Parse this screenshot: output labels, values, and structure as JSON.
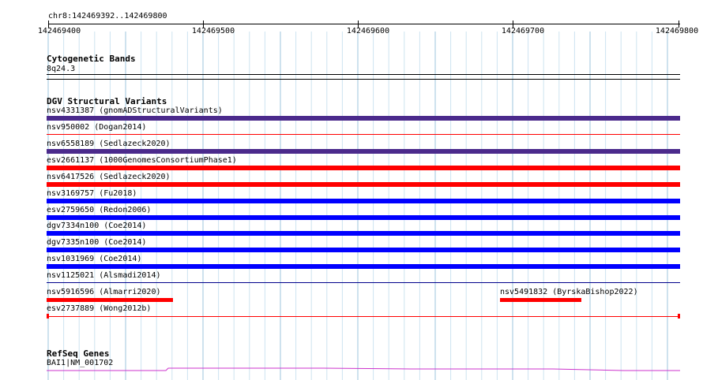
{
  "ruler": {
    "location": "chr8:142469392..142469800",
    "ticks": [
      "142469400",
      "142469500",
      "142469600",
      "142469700",
      "142469800"
    ]
  },
  "tracks": {
    "cytoband": {
      "title": "Cytogenetic Bands",
      "band": "8q24.3"
    },
    "dgv": {
      "title": "DGV Structural Variants",
      "features": [
        {
          "label": "nsv4331387 (gnomADStructuralVariants)",
          "color": "#4b2a8c",
          "style": "thick"
        },
        {
          "label": "nsv950002 (Dogan2014)",
          "color": "#ff0000",
          "style": "thin"
        },
        {
          "label": "nsv6558189 (Sedlazeck2020)",
          "color": "#4b2a8c",
          "style": "thick"
        },
        {
          "label": "esv2661137 (1000GenomesConsortiumPhase1)",
          "color": "#ff0000",
          "style": "thick"
        },
        {
          "label": "nsv6417526 (Sedlazeck2020)",
          "color": "#ff0000",
          "style": "thick"
        },
        {
          "label": "nsv3169757 (Fu2018)",
          "color": "#0000ff",
          "style": "thick"
        },
        {
          "label": "esv2759650 (Redon2006)",
          "color": "#0000ff",
          "style": "thick"
        },
        {
          "label": "dgv7334n100 (Coe2014)",
          "color": "#0000ff",
          "style": "thick"
        },
        {
          "label": "dgv7335n100 (Coe2014)",
          "color": "#0000ff",
          "style": "thick"
        },
        {
          "label": "nsv1031969 (Coe2014)",
          "color": "#0000ff",
          "style": "thick"
        },
        {
          "label": "nsv1125021 (Alsmadi2014)",
          "color": "#00008b",
          "style": "thin"
        }
      ],
      "partial_features": [
        {
          "label": "nsv5916596 (Almarri2020)",
          "color": "#ff0000"
        },
        {
          "label": "nsv5491832 (ByrskaBishop2022)",
          "color": "#ff0000"
        }
      ],
      "last_feature": {
        "label": "esv2737889 (Wong2012b)",
        "color": "#ff0000"
      }
    },
    "refseq": {
      "title": "RefSeq Genes",
      "gene": "BAI1|NM_001702",
      "color": "#cc33cc"
    }
  }
}
